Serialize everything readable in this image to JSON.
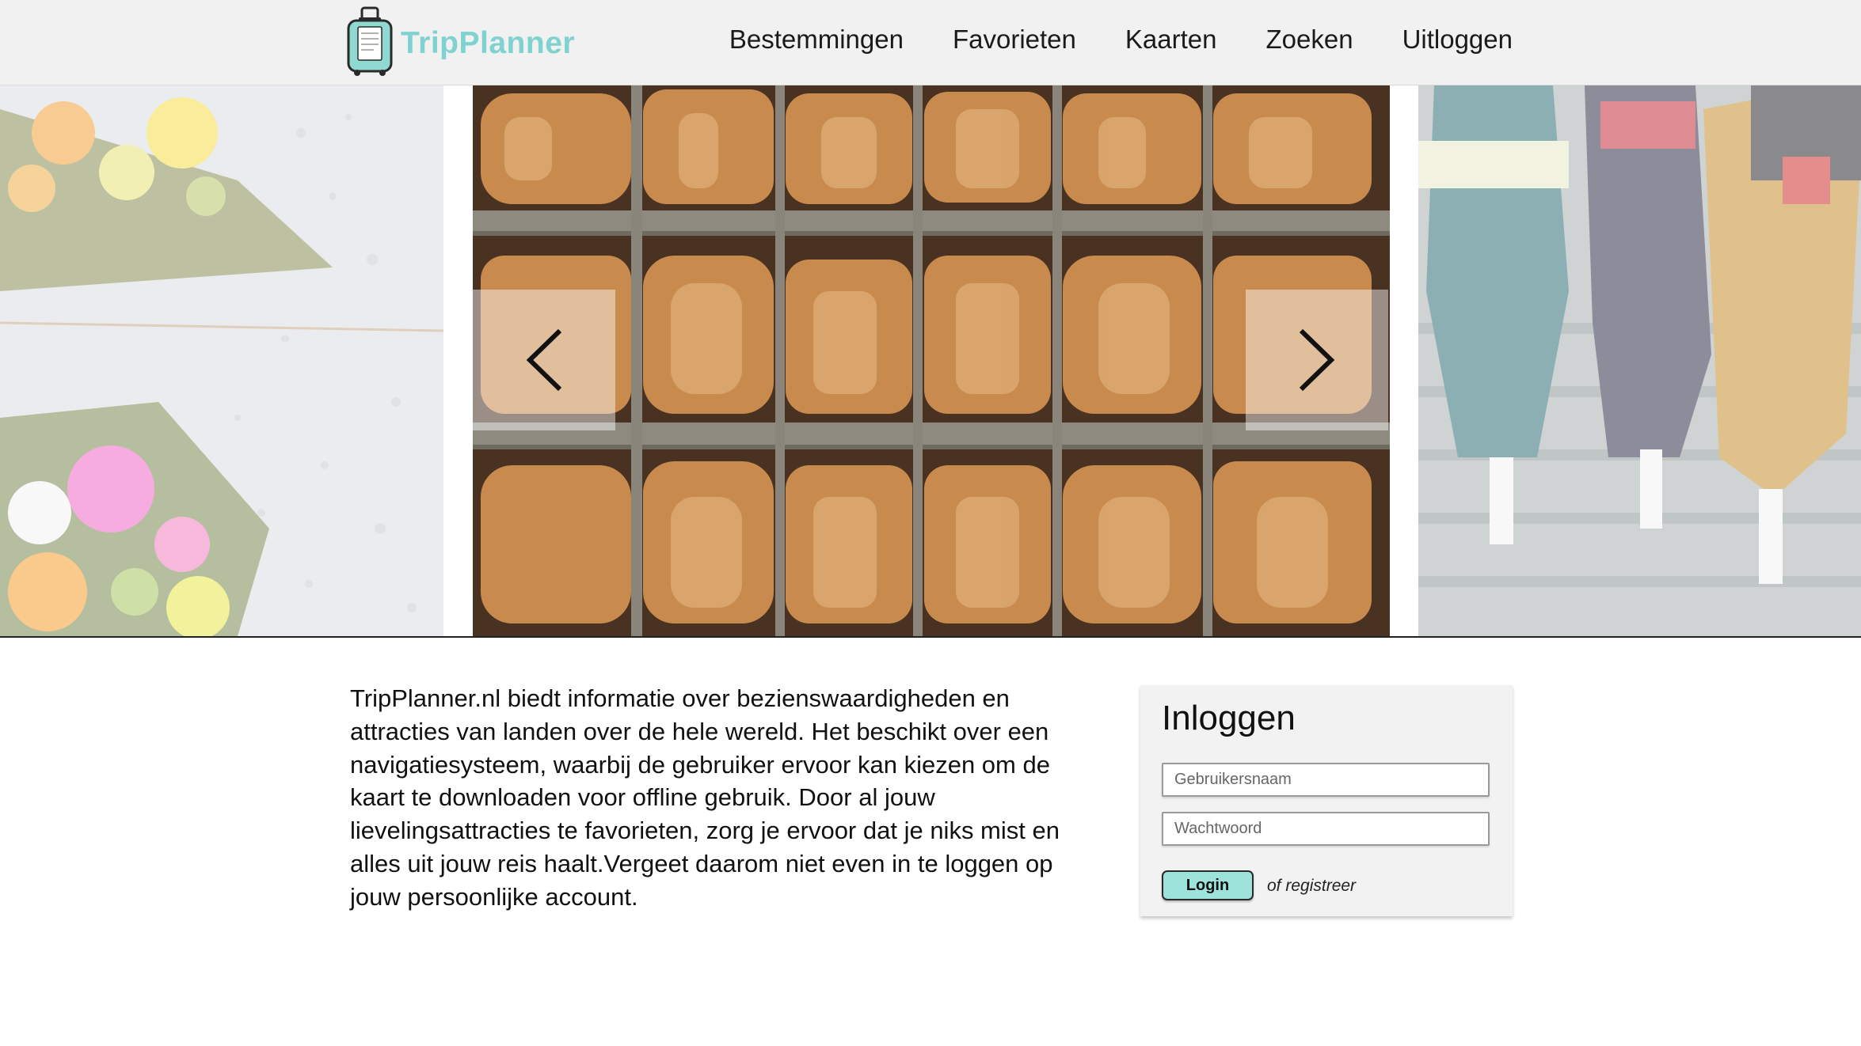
{
  "header": {
    "logo_text": "TripPlanner",
    "nav": [
      {
        "label": "Bestemmingen"
      },
      {
        "label": "Favorieten"
      },
      {
        "label": "Kaarten"
      },
      {
        "label": "Zoeken"
      },
      {
        "label": "Uitloggen"
      }
    ]
  },
  "carousel": {
    "prev_icon": "chevron-left-icon",
    "next_icon": "chevron-right-icon"
  },
  "intro": {
    "text": "TripPlanner.nl biedt informatie over bezienswaardigheden en attracties van landen over de hele wereld. Het beschikt over een navigatiesysteem, waarbij de gebruiker ervoor kan kiezen om de kaart te downloaden voor offline gebruik. Door al jouw lievelingsattracties te favorieten, zorg je ervoor dat je niks mist en alles uit jouw reis haalt.Vergeet daarom niet even in te loggen op jouw persoonlijke account."
  },
  "login": {
    "title": "Inloggen",
    "username_placeholder": "Gebruikersnaam",
    "password_placeholder": "Wachtwoord",
    "button_label": "Login",
    "register_label": "of registreer"
  },
  "colors": {
    "brand": "#7fd2cf",
    "button": "#9ee3db",
    "header_bg": "#f1f1f1"
  }
}
